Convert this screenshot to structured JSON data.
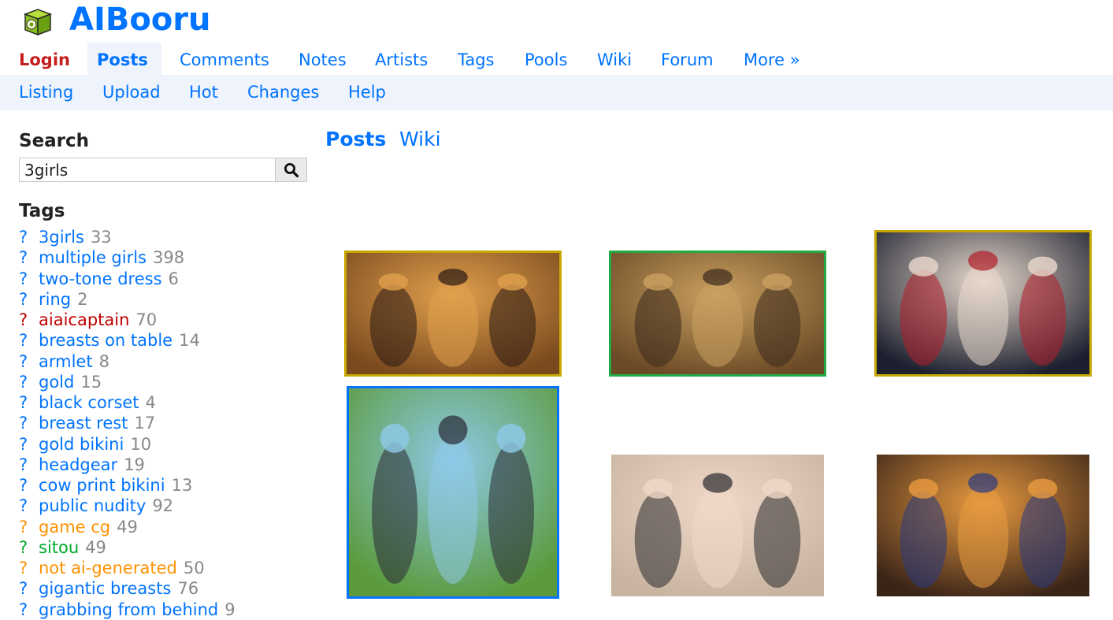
{
  "site": {
    "title": "AIBooru",
    "logo_icon": "cube-logo-icon"
  },
  "main_nav": [
    {
      "label": "Login",
      "type": "login"
    },
    {
      "label": "Posts",
      "type": "active"
    },
    {
      "label": "Comments"
    },
    {
      "label": "Notes"
    },
    {
      "label": "Artists"
    },
    {
      "label": "Tags"
    },
    {
      "label": "Pools"
    },
    {
      "label": "Wiki"
    },
    {
      "label": "Forum"
    },
    {
      "label": "More »"
    }
  ],
  "sub_nav": [
    "Listing",
    "Upload",
    "Hot",
    "Changes",
    "Help"
  ],
  "search": {
    "heading": "Search",
    "value": "3girls",
    "button_icon": "search-icon"
  },
  "tags": {
    "heading": "Tags",
    "items": [
      {
        "q": "?",
        "name": "3girls",
        "count": "33",
        "color": "#0073ff"
      },
      {
        "q": "?",
        "name": "multiple girls",
        "count": "398",
        "color": "#0073ff"
      },
      {
        "q": "?",
        "name": "two-tone dress",
        "count": "6",
        "color": "#0073ff"
      },
      {
        "q": "?",
        "name": "ring",
        "count": "2",
        "color": "#0073ff"
      },
      {
        "q": "?",
        "name": "aiaicaptain",
        "count": "70",
        "color": "#c00000"
      },
      {
        "q": "?",
        "name": "breasts on table",
        "count": "14",
        "color": "#0073ff"
      },
      {
        "q": "?",
        "name": "armlet",
        "count": "8",
        "color": "#0073ff"
      },
      {
        "q": "?",
        "name": "gold",
        "count": "15",
        "color": "#0073ff"
      },
      {
        "q": "?",
        "name": "black corset",
        "count": "4",
        "color": "#0073ff"
      },
      {
        "q": "?",
        "name": "breast rest",
        "count": "17",
        "color": "#0073ff"
      },
      {
        "q": "?",
        "name": "gold bikini",
        "count": "10",
        "color": "#0073ff"
      },
      {
        "q": "?",
        "name": "headgear",
        "count": "19",
        "color": "#0073ff"
      },
      {
        "q": "?",
        "name": "cow print bikini",
        "count": "13",
        "color": "#0073ff"
      },
      {
        "q": "?",
        "name": "public nudity",
        "count": "92",
        "color": "#0073ff"
      },
      {
        "q": "?",
        "name": "game cg",
        "count": "49",
        "color": "#fd9200"
      },
      {
        "q": "?",
        "name": "sitou",
        "count": "49",
        "color": "#00ab2c"
      },
      {
        "q": "?",
        "name": "not ai-generated",
        "count": "50",
        "color": "#fd9200"
      },
      {
        "q": "?",
        "name": "gigantic breasts",
        "count": "76",
        "color": "#0073ff"
      },
      {
        "q": "?",
        "name": "grabbing from behind",
        "count": "9",
        "color": "#0073ff"
      }
    ]
  },
  "content_tabs": [
    {
      "label": "Posts",
      "active": true
    },
    {
      "label": "Wiki",
      "active": false
    }
  ],
  "posts": [
    {
      "border": "#c8a800",
      "palette": [
        "#7a4a1e",
        "#e1a04d",
        "#2a1a14"
      ]
    },
    {
      "border": "#22aa44",
      "palette": [
        "#6b4a26",
        "#caa060",
        "#3a2a1e"
      ]
    },
    {
      "border": "#c8a800",
      "palette": [
        "#1b1f2e",
        "#e8d8cc",
        "#b01e2a"
      ]
    },
    {
      "border": "#0073ff",
      "palette": [
        "#5a9a3a",
        "#8fc9e8",
        "#2a2a34"
      ]
    },
    {
      "border": "none",
      "palette": [
        "#c8b4a0",
        "#f0d8c8",
        "#2a2a2e"
      ]
    },
    {
      "border": "none",
      "palette": [
        "#3a2418",
        "#e89a40",
        "#2a3a80"
      ]
    }
  ],
  "colors": {
    "link": "#0073ff",
    "login": "#c41e1e",
    "subnav_bg": "#eef3fc",
    "count": "#888888"
  }
}
